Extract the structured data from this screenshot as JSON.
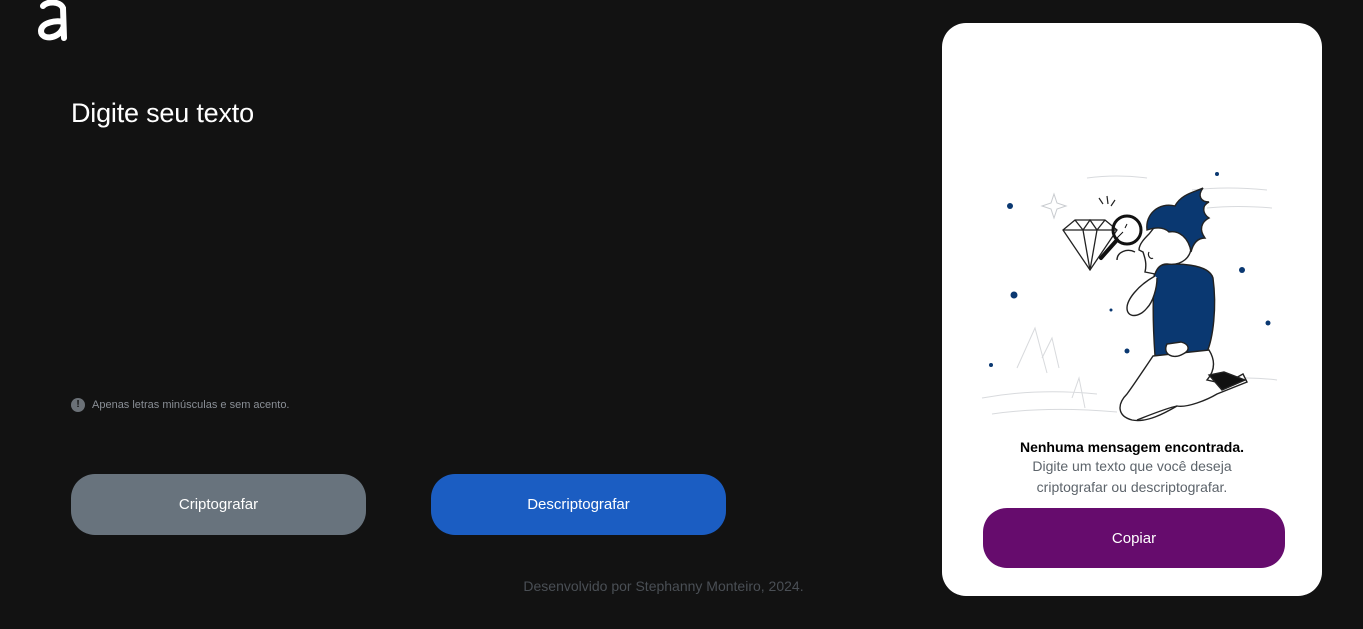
{
  "logo": {
    "icon": "alura-logo-icon"
  },
  "main": {
    "title": "Digite seu texto",
    "input_value": "",
    "hint": {
      "icon": "exclamation-circle-icon",
      "text": "Apenas letras minúsculas e sem acento."
    },
    "buttons": {
      "encrypt_label": "Criptografar",
      "decrypt_label": "Descriptografar"
    }
  },
  "footer": {
    "text": "Desenvolvido por Stephanny Monteiro, 2024."
  },
  "output_panel": {
    "illustration": "person-with-magnifying-glass-and-diamond",
    "empty_title": "Nenhuma mensagem encontrada.",
    "empty_description": "Digite um texto que você deseja criptografar ou descriptografar.",
    "copy_label": "Copiar"
  },
  "colors": {
    "background": "#121212",
    "encrypt_button": "#68737d",
    "decrypt_button": "#1b5dc2",
    "copy_button": "#660c6d",
    "card": "#ffffff",
    "illustration_accent": "#0a3871"
  }
}
